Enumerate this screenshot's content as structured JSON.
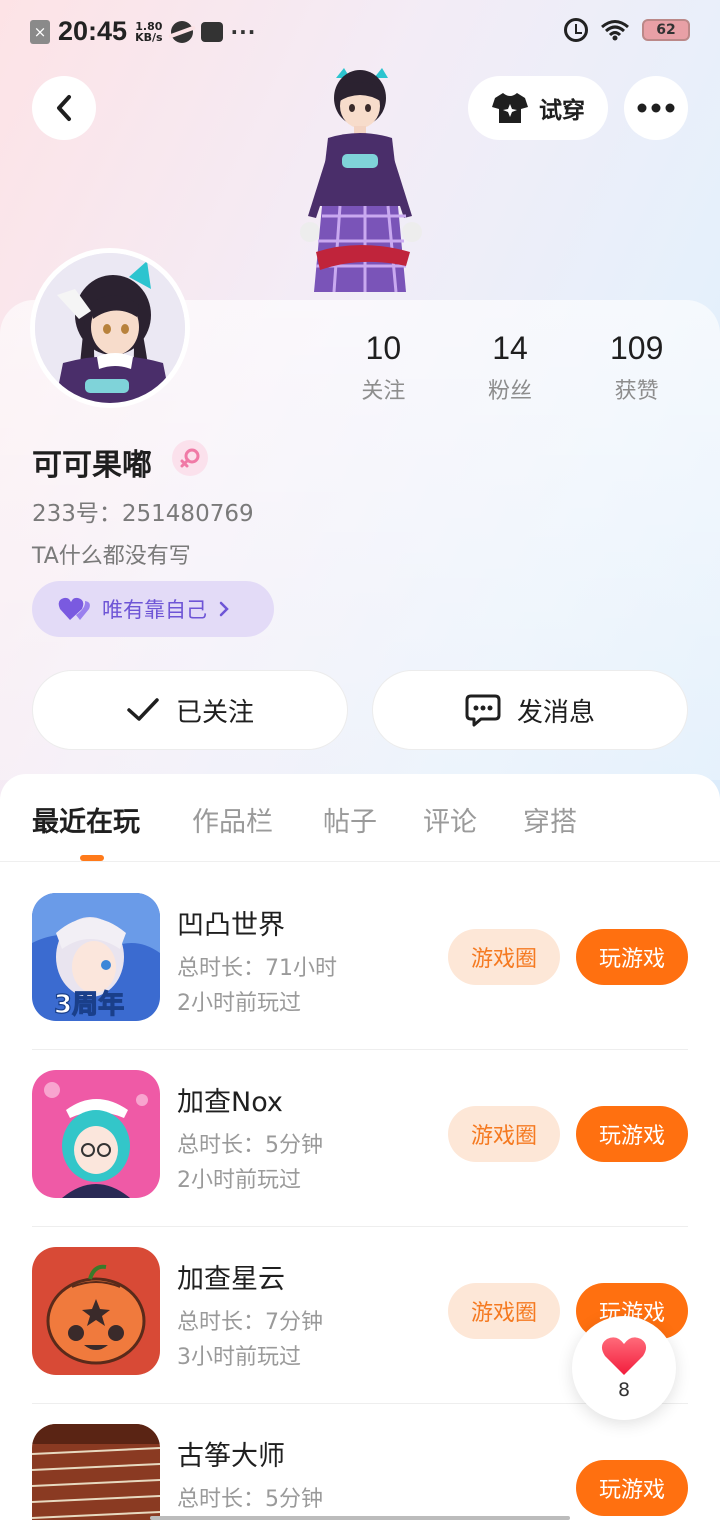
{
  "status_bar": {
    "time": "20:45",
    "speed_value": "1.80",
    "speed_unit": "KB/s",
    "more": "···",
    "battery": "62"
  },
  "header": {
    "try_on_label": "试穿"
  },
  "profile": {
    "name": "可可果嘟",
    "id_line": "233号：251480769",
    "bio": "TA什么都没有写",
    "tag_label": "唯有靠自己",
    "stats": [
      {
        "value": "10",
        "label": "关注"
      },
      {
        "value": "14",
        "label": "粉丝"
      },
      {
        "value": "109",
        "label": "获赞"
      }
    ]
  },
  "actions": {
    "follow_label": "已关注",
    "message_label": "发消息"
  },
  "tabs": [
    {
      "label": "最近在玩",
      "active": true
    },
    {
      "label": "作品栏",
      "active": false
    },
    {
      "label": "帖子",
      "active": false
    },
    {
      "label": "评论",
      "active": false
    },
    {
      "label": "穿搭",
      "active": false
    }
  ],
  "games": [
    {
      "name": "凹凸世界",
      "duration": "总时长：71小时",
      "last_played": "2小时前玩过",
      "circle_label": "游戏圈",
      "play_label": "玩游戏",
      "icon_badge": "3周年"
    },
    {
      "name": "加查Nox",
      "duration": "总时长：5分钟",
      "last_played": "2小时前玩过",
      "circle_label": "游戏圈",
      "play_label": "玩游戏"
    },
    {
      "name": "加查星云",
      "duration": "总时长：7分钟",
      "last_played": "3小时前玩过",
      "circle_label": "游戏圈",
      "play_label": "玩游戏"
    },
    {
      "name": "古筝大师",
      "duration": "总时长：5分钟",
      "last_played": "",
      "play_label": "玩游戏"
    }
  ],
  "like_float": {
    "count": "8"
  },
  "colors": {
    "accent_orange": "#ff7010",
    "circle_bg": "#fde7d7",
    "tag_bg": "#e3dbf7",
    "tag_text": "#6e55d6"
  }
}
